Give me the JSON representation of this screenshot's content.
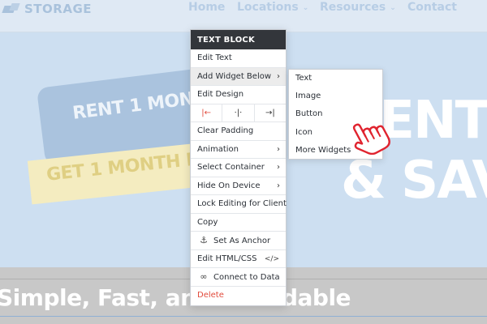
{
  "site": {
    "logo_text": "STORAGE",
    "nav": [
      {
        "label": "Home",
        "has_caret": false
      },
      {
        "label": "Locations",
        "has_caret": true
      },
      {
        "label": "Resources",
        "has_caret": true
      },
      {
        "label": "Contact",
        "has_caret": false
      }
    ],
    "caret_glyph": "⌄",
    "hero": {
      "tag_blue_text": "RENT 1 MONTH",
      "tag_yellow_text": "GET 1 MONTH FREE",
      "headline_line1": "RENT O",
      "headline_line2": "& SAVE"
    },
    "band_text": "Simple, Fast, and Affordable"
  },
  "menu": {
    "title": "TEXT BLOCK",
    "items": {
      "edit_text": "Edit Text",
      "add_widget_below": "Add Widget Below",
      "edit_design": "Edit Design",
      "clear_padding": "Clear Padding",
      "animation": "Animation",
      "select_container": "Select Container",
      "hide_on_device": "Hide On Device",
      "lock_editing": "Lock Editing for Client",
      "copy": "Copy",
      "set_as_anchor": "Set As Anchor",
      "edit_html_css": "Edit HTML/CSS",
      "connect_to_data": "Connect to Data",
      "delete": "Delete"
    },
    "chevron": "›",
    "align": {
      "left": "|←",
      "center": "⋅|⋅",
      "right": "→|"
    },
    "icons": {
      "anchor": "⚓",
      "code": "</>",
      "link": "∞"
    },
    "accent_color": "#e14a3b",
    "header_color": "#33363b"
  },
  "submenu": {
    "items": [
      "Text",
      "Image",
      "Button",
      "Icon",
      "More Widgets"
    ]
  },
  "cursor": {
    "icon": "hand-pointer-icon",
    "color": "#e0242f"
  }
}
